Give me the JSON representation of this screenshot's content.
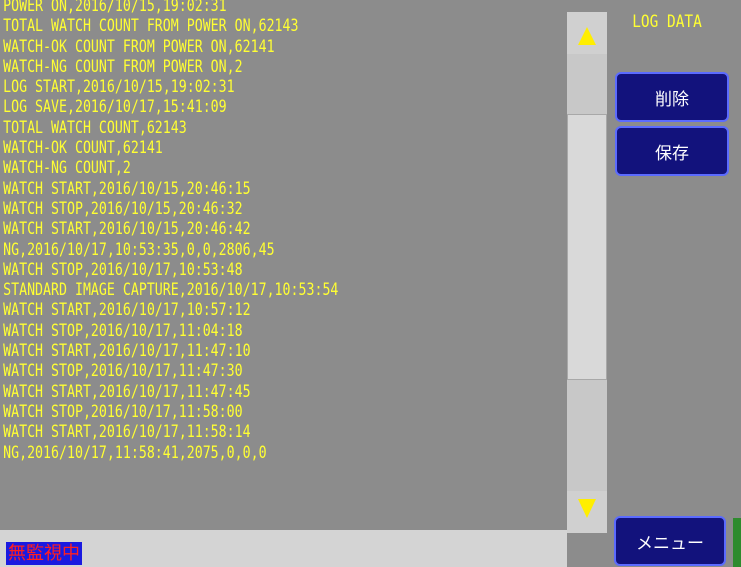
{
  "log": {
    "lines": [
      "POWER ON,2016/10/15,19:02:31",
      "TOTAL WATCH COUNT FROM POWER ON,62143",
      "WATCH-OK COUNT FROM POWER ON,62141",
      "WATCH-NG COUNT FROM POWER ON,2",
      "LOG START,2016/10/15,19:02:31",
      "LOG SAVE,2016/10/17,15:41:09",
      "TOTAL WATCH COUNT,62143",
      "WATCH-OK COUNT,62141",
      "WATCH-NG COUNT,2",
      "WATCH START,2016/10/15,20:46:15",
      "WATCH STOP,2016/10/15,20:46:32",
      "WATCH START,2016/10/15,20:46:42",
      "NG,2016/10/17,10:53:35,0,0,2806,45",
      "WATCH STOP,2016/10/17,10:53:48",
      "STANDARD IMAGE CAPTURE,2016/10/17,10:53:54",
      "WATCH START,2016/10/17,10:57:12",
      "WATCH STOP,2016/10/17,11:04:18",
      "WATCH START,2016/10/17,11:47:10",
      "WATCH STOP,2016/10/17,11:47:30",
      "WATCH START,2016/10/17,11:47:45",
      "WATCH STOP,2016/10/17,11:58:00",
      "WATCH START,2016/10/17,11:58:14",
      "NG,2016/10/17,11:58:41,2075,0,0,0"
    ]
  },
  "status": {
    "text": "無監視中"
  },
  "panel": {
    "title": "LOG DATA",
    "delete_label": "削除",
    "save_label": "保存",
    "menu_label": "メニュー"
  },
  "colors": {
    "log_text": "#ffff33",
    "panel_bg": "#8c8c8c",
    "button_bg": "#12127c",
    "scroll_arrow": "#ffee00",
    "status_text": "#ff2020"
  },
  "icons": {
    "scroll_up": "triangle-up-icon",
    "scroll_down": "triangle-down-icon"
  }
}
